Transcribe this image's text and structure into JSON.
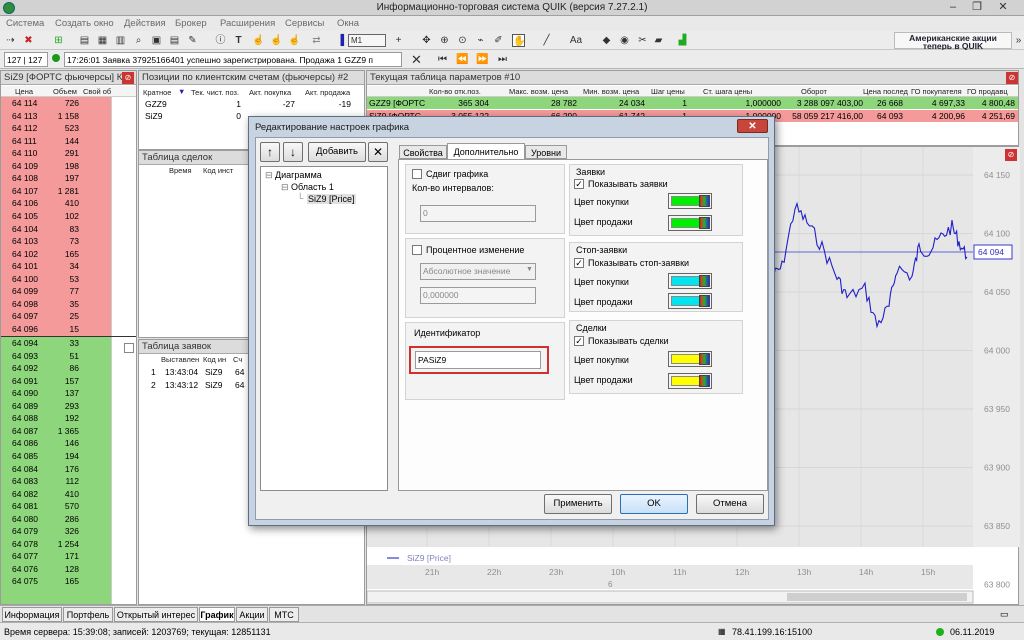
{
  "app": {
    "title": "Информационно-торговая система QUIK (версия 7.27.2.1)"
  },
  "menu": [
    "Система",
    "Создать окно",
    "Действия",
    "Брокер",
    "Расширения",
    "Сервисы",
    "Окна"
  ],
  "toolbar": {
    "interval": "M1",
    "font": "Aa",
    "ad_line1": "Американские акции",
    "ad_line2": "теперь в QUIK"
  },
  "toolbar2": {
    "counter": "127 | 127",
    "message": "17:26:01  Заявка 37925166401 успешно зарегистрирована. Продажа 1 GZZ9 п"
  },
  "orderbook": {
    "title": "SiZ9 [ФОРТС фьючерсы] К",
    "headers": [
      "Цена",
      "Объем",
      "Свой об"
    ],
    "sell": [
      {
        "p": "64 114",
        "v": "726"
      },
      {
        "p": "64 113",
        "v": "1 158"
      },
      {
        "p": "64 112",
        "v": "523"
      },
      {
        "p": "64 111",
        "v": "144"
      },
      {
        "p": "64 110",
        "v": "291"
      },
      {
        "p": "64 109",
        "v": "198"
      },
      {
        "p": "64 108",
        "v": "197"
      },
      {
        "p": "64 107",
        "v": "1 281"
      },
      {
        "p": "64 106",
        "v": "410"
      },
      {
        "p": "64 105",
        "v": "102"
      },
      {
        "p": "64 104",
        "v": "83"
      },
      {
        "p": "64 103",
        "v": "73"
      },
      {
        "p": "64 102",
        "v": "165"
      },
      {
        "p": "64 101",
        "v": "34"
      },
      {
        "p": "64 100",
        "v": "53"
      },
      {
        "p": "64 099",
        "v": "77"
      },
      {
        "p": "64 098",
        "v": "35"
      },
      {
        "p": "64 097",
        "v": "25"
      },
      {
        "p": "64 096",
        "v": "15"
      }
    ],
    "buy": [
      {
        "p": "64 094",
        "v": "33"
      },
      {
        "p": "64 093",
        "v": "51"
      },
      {
        "p": "64 092",
        "v": "86"
      },
      {
        "p": "64 091",
        "v": "157"
      },
      {
        "p": "64 090",
        "v": "137"
      },
      {
        "p": "64 089",
        "v": "293"
      },
      {
        "p": "64 088",
        "v": "192"
      },
      {
        "p": "64 087",
        "v": "1 365"
      },
      {
        "p": "64 086",
        "v": "146"
      },
      {
        "p": "64 085",
        "v": "194"
      },
      {
        "p": "64 084",
        "v": "176"
      },
      {
        "p": "64 083",
        "v": "112"
      },
      {
        "p": "64 082",
        "v": "410"
      },
      {
        "p": "64 081",
        "v": "570"
      },
      {
        "p": "64 080",
        "v": "286"
      },
      {
        "p": "64 079",
        "v": "326"
      },
      {
        "p": "64 078",
        "v": "1 254"
      },
      {
        "p": "64 077",
        "v": "171"
      },
      {
        "p": "64 076",
        "v": "128"
      },
      {
        "p": "64 075",
        "v": "165"
      }
    ]
  },
  "positions": {
    "title": "Позиции по клиентским счетам (фьючерсы) #2",
    "headers": [
      "Кратное",
      "Тек. чист. поз.",
      "Акт. покупка",
      "Акт. продажа"
    ],
    "rows": [
      [
        "GZZ9",
        "1",
        "-27",
        "-19"
      ],
      [
        "SiZ9",
        "0",
        "",
        ""
      ]
    ]
  },
  "deals": {
    "title": "Таблица сделок",
    "headers": [
      "Время",
      "Код инст"
    ]
  },
  "orders": {
    "title": "Таблица заявок",
    "headers": [
      "Выставлен",
      "Код ин",
      "Сч"
    ],
    "rows": [
      [
        "1",
        "13:43:04",
        "SiZ9",
        "64"
      ],
      [
        "2",
        "13:43:12",
        "SiZ9",
        "64"
      ]
    ]
  },
  "params": {
    "title": "Текущая таблица параметров #10",
    "headers": [
      "Кол-во отк.поз.",
      "Макс. возм. цена",
      "Мин. возм. цена",
      "Шаг цены",
      "Ст. шага цены",
      "Оборот",
      "Цена послед",
      "ГО покупателя",
      "ГО продавц"
    ],
    "rows": [
      [
        "GZZ9 [ФОРТС",
        "365 304",
        "28 782",
        "24 034",
        "1",
        "1,000000",
        "3 288 097 403,00",
        "26 668",
        "4 697,33",
        "4 800,48"
      ],
      [
        "SiZ9 [ФОРТС",
        "3 055 122",
        "66 290",
        "61 742",
        "1",
        "1,000000",
        "58 059 217 416,00",
        "64 093",
        "4 200,96",
        "4 251,69"
      ]
    ]
  },
  "chart": {
    "legend": "SiZ9 [Price]",
    "yticks": [
      "64 150",
      "64 100",
      "64 050",
      "64 000",
      "63 950",
      "63 900",
      "63 850",
      "63 800"
    ],
    "last_price": "64 094",
    "xticks": [
      "21h",
      "22h",
      "23h",
      "10h",
      "11h",
      "12h",
      "13h",
      "14h",
      "15h"
    ],
    "xsub": "6"
  },
  "dialog": {
    "title": "Редактирование настроек графика",
    "add_label": "Добавить",
    "tree": [
      "Диаграмма",
      "Область 1",
      "SiZ9 [Price]"
    ],
    "tabs": [
      "Свойства",
      "Дополнительно",
      "Уровни"
    ],
    "shift_label": "Сдвиг графика",
    "intervals_label": "Кол-во интервалов:",
    "intervals_value": "0",
    "percent_label": "Процентное изменение",
    "abs_value": "Абсолютное значение",
    "percent_value": "0,000000",
    "ident_title": "Идентификатор",
    "ident_value": "PASiZ9",
    "orders_title": "Заявки",
    "show_orders": "Показывать заявки",
    "stop_title": "Стоп-заявки",
    "show_stop": "Показывать стоп-заявки",
    "deals_title": "Сделки",
    "show_deals": "Показывать сделки",
    "buy_color_label": "Цвет покупки",
    "sell_color_label": "Цвет продажи",
    "colors": {
      "orders": "#00ee00",
      "stop": "#00e5ee",
      "deals": "#ffff00"
    },
    "apply": "Применить",
    "ok": "OK",
    "cancel": "Отмена"
  },
  "bottom_tabs": [
    "Информация",
    "Портфель",
    "Открытый интерес",
    "График",
    "Акции",
    "МТС"
  ],
  "status": {
    "server_time": "Время сервера: 15:39:08; записей: 1203769; текущая: 12851131",
    "ip": "78.41.199.16:15100",
    "date": "06.11.2019"
  }
}
